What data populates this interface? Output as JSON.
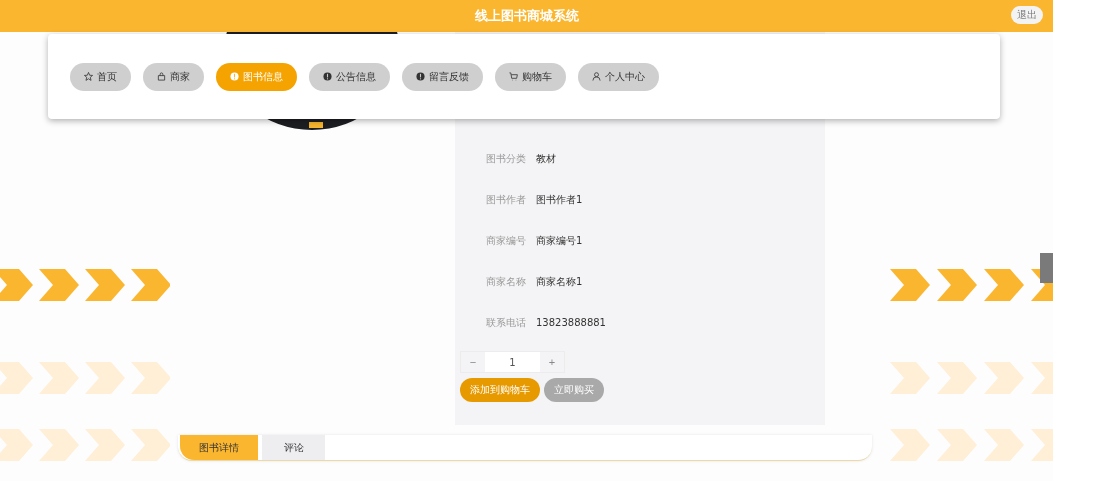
{
  "header": {
    "title": "线上图书商城系统",
    "logout": "退出"
  },
  "nav": [
    {
      "label": "首页",
      "selected": false
    },
    {
      "label": "商家",
      "selected": false
    },
    {
      "label": "图书信息",
      "selected": true
    },
    {
      "label": "公告信息",
      "selected": false
    },
    {
      "label": "留言反馈",
      "selected": false
    },
    {
      "label": "购物车",
      "selected": false
    },
    {
      "label": "个人中心",
      "selected": false
    }
  ],
  "details": [
    {
      "label": "图书分类",
      "value": "教材"
    },
    {
      "label": "图书作者",
      "value": "图书作者1"
    },
    {
      "label": "商家编号",
      "value": "商家编号1"
    },
    {
      "label": "商家名称",
      "value": "商家名称1"
    },
    {
      "label": "联系电话",
      "value": "13823888881"
    }
  ],
  "quantity": {
    "minus": "−",
    "value": "1",
    "plus": "+"
  },
  "actions": {
    "add_to_cart": "添加到购物车",
    "buy_now": "立即购买"
  },
  "tabs": [
    {
      "label": "图书详情",
      "selected": true
    },
    {
      "label": "评论",
      "selected": false
    }
  ]
}
